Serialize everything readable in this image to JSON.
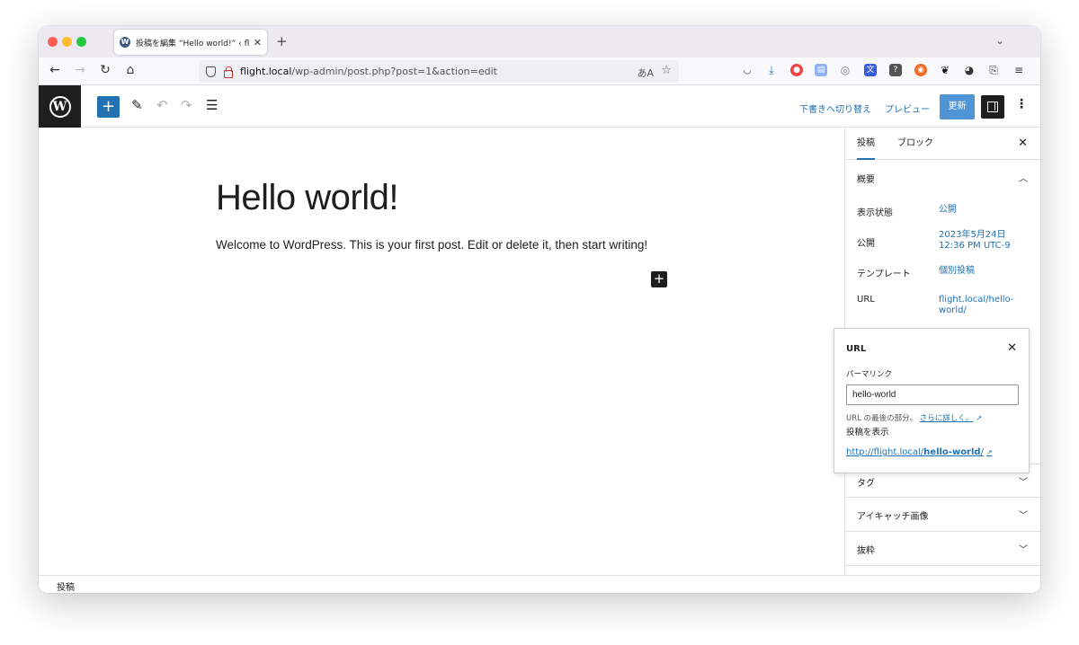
{
  "browser": {
    "tab_title": "投稿を編集 “Hello world!” ‹ flight",
    "tab_favicon": "W",
    "url_host": "flight.local",
    "url_path": "/wp-admin/post.php?post=1&action=edit"
  },
  "header": {
    "switch_to_draft": "下書きへ切り替え",
    "preview": "プレビュー",
    "update": "更新"
  },
  "editor": {
    "title": "Hello world!",
    "paragraph": "Welcome to WordPress. This is your first post. Edit or delete it, then start writing!"
  },
  "sidebar": {
    "tabs": [
      "投稿",
      "ブロック"
    ],
    "summary": {
      "heading": "概要",
      "rows": [
        {
          "label": "表示状態",
          "value": "公開"
        },
        {
          "label": "公開",
          "value_line1": "2023年5月24日",
          "value_line2": "12:36 PM UTC-9"
        },
        {
          "label": "テンプレート",
          "value": "個別投稿"
        },
        {
          "label": "URL",
          "value_line1": "flight.local/hello-",
          "value_line2": "world/"
        }
      ]
    },
    "panels": [
      "タグ",
      "アイキャッチ画像",
      "抜粋"
    ]
  },
  "url_popover": {
    "title": "URL",
    "permalink_label": "パーマリンク",
    "slug": "hello-world",
    "help_text": "URL の最後の部分。",
    "help_link": "さらに詳しく。",
    "view_post": "投稿を表示",
    "permalink_prefix": "http://flight.local/",
    "permalink_slug": "hello-world",
    "permalink_suffix": "/"
  },
  "footer": {
    "breadcrumb": "投稿"
  },
  "colors": {
    "accent": "#2271b1",
    "update_button": "#4f94d4",
    "dark": "#1e1e1e"
  }
}
